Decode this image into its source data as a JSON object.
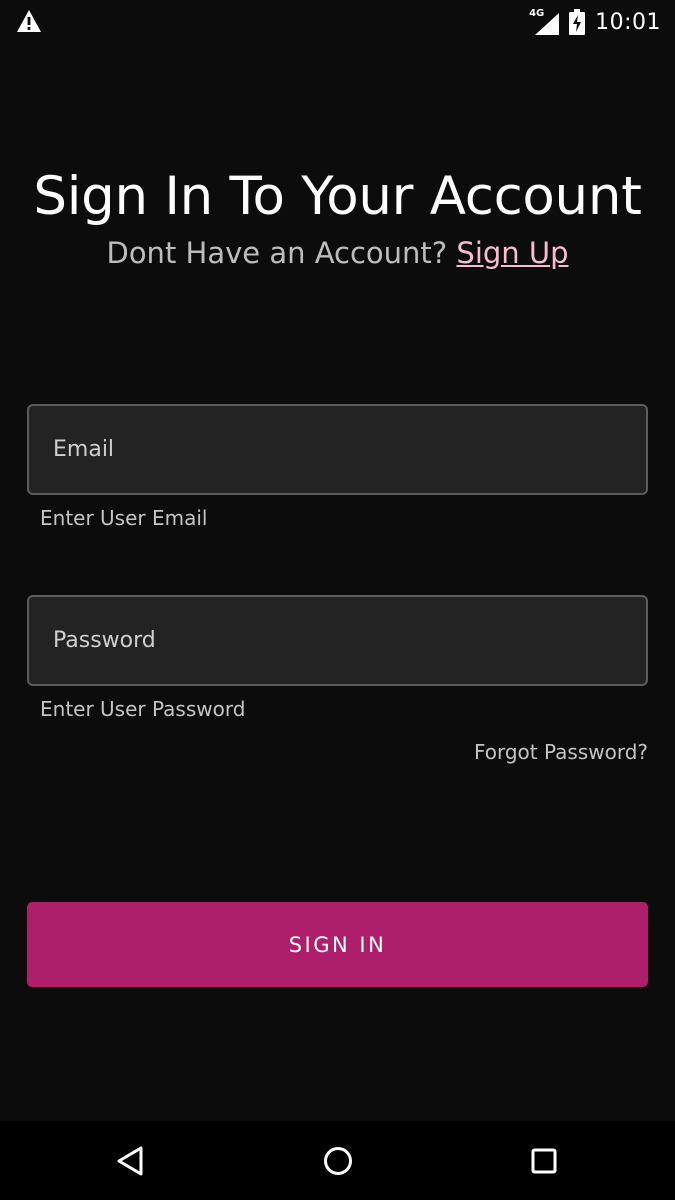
{
  "status_bar": {
    "alert_icon": "warning-icon",
    "network_type": "4G",
    "signal_icon": "cell-signal-icon",
    "battery_icon": "battery-charging-icon",
    "time": "10:01"
  },
  "header": {
    "title": "Sign In To Your Account",
    "subtitle_prompt": "Dont Have an Account?",
    "signup_label": "Sign Up"
  },
  "form": {
    "email": {
      "placeholder": "Email",
      "value": "",
      "helper": "Enter User Email"
    },
    "password": {
      "placeholder": "Password",
      "value": "",
      "helper": "Enter User Password"
    },
    "forgot_password_label": "Forgot Password?",
    "submit_label": "SIGN IN"
  },
  "nav_bar": {
    "back_icon": "back-triangle-icon",
    "home_icon": "home-circle-icon",
    "recents_icon": "recents-square-icon"
  },
  "colors": {
    "background": "#0c0c0c",
    "accent": "#ad1f6b",
    "link": "#f8bbd0",
    "field_background": "#232323"
  }
}
